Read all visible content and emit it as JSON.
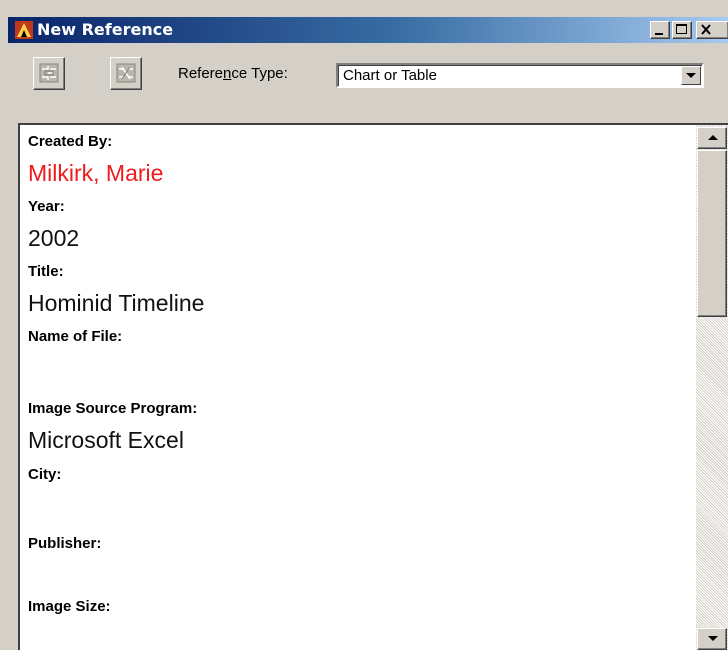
{
  "window": {
    "title": "New Reference",
    "controls": {
      "minimize": "minimize",
      "maximize": "maximize",
      "close": "close"
    }
  },
  "toolbar": {
    "reference_type_label_before": "Refere",
    "reference_type_label_accel": "n",
    "reference_type_label_after": "ce Type:",
    "reference_type_value": "Chart or Table"
  },
  "fields": [
    {
      "label": "Created By:",
      "value": "Milkirk, Marie"
    },
    {
      "label": "Year:",
      "value": "2002"
    },
    {
      "label": "Title:",
      "value": "Hominid Timeline"
    },
    {
      "label": "Name of File:",
      "value": ""
    },
    {
      "label": "Image Source Program:",
      "value": "Microsoft Excel"
    },
    {
      "label": "City:",
      "value": ""
    },
    {
      "label": "Publisher:",
      "value": ""
    },
    {
      "label": "Image Size:",
      "value": ""
    }
  ],
  "colors": {
    "titlebar_start": "#0a246a",
    "titlebar_end": "#a6caf0",
    "author_value": "#ee1c1c",
    "window_face": "#d4d0c8"
  },
  "icons": {
    "app": "app-window-icon",
    "tool1": "link-reference-icon",
    "tool2": "unlink-reference-icon",
    "combo": "chevron-down-icon",
    "scroll_up": "scroll-up-arrow-icon",
    "scroll_down": "scroll-down-arrow-icon"
  }
}
